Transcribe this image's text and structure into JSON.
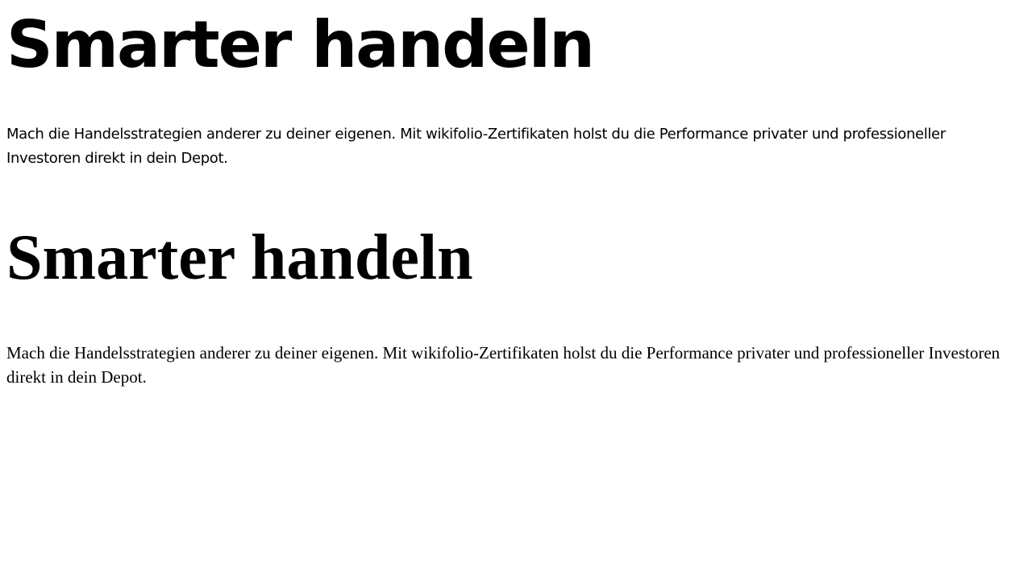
{
  "sections": [
    {
      "heading": "Smarter handeln",
      "body": "Mach die Handelsstrategien anderer zu deiner eigenen. Mit wikifolio-Zertifikaten holst du die Performance privater und professioneller Investoren direkt in dein Depot."
    },
    {
      "heading": "Smarter handeln",
      "body": "Mach die Handelsstrategien anderer zu deiner eigenen. Mit wikifolio-Zertifikaten holst du die Performance privater und professioneller Investoren direkt in dein Depot."
    }
  ]
}
